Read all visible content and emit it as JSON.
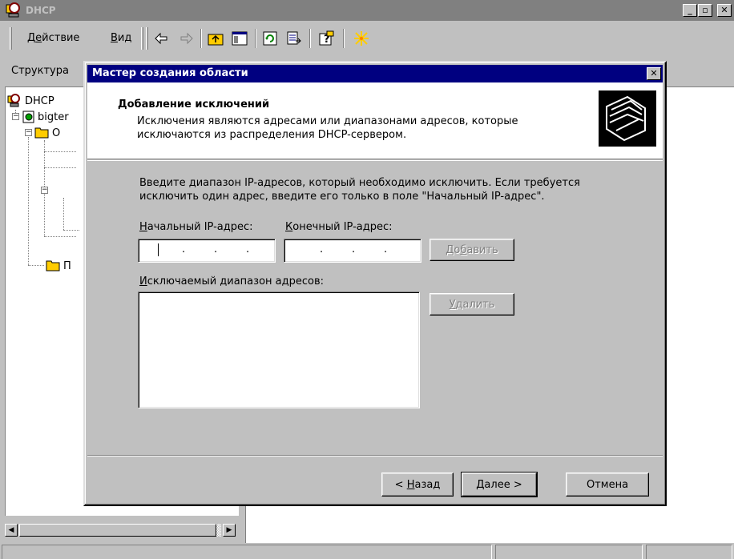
{
  "window": {
    "title": "DHCP"
  },
  "menu": {
    "action_pre": "Д",
    "action_ul": "е",
    "action_post": "йствие",
    "view_pre": "",
    "view_ul": "В",
    "view_post": "ид"
  },
  "tabs": {
    "structure": "Структура"
  },
  "tree": {
    "root": "DHCP",
    "server_partial": "bigter",
    "child1_partial": "О",
    "child2_partial": "П"
  },
  "dialog": {
    "title": "Мастер создания области",
    "header_title": "Добавление исключений",
    "header_description": "Исключения являются адресами или диапазонами адресов, которые исключаются из распределения DHCP-сервером.",
    "body_text": "Введите диапазон IP-адресов, который необходимо исключить. Если требуется исключить один адрес, введите его только в поле \"Начальный IP-адрес\".",
    "start_ip_label_ul": "Н",
    "start_ip_label_rest": "ачальный IP-адрес:",
    "end_ip_label_ul": "К",
    "end_ip_label_rest": "онечный IP-адрес:",
    "start_ip_value": "",
    "end_ip_value": "",
    "add_button_pre": "До",
    "add_button_ul": "б",
    "add_button_post": "авить",
    "excluded_label_ul": "И",
    "excluded_label_rest": "сключаемый диапазон адресов:",
    "excluded_list": [],
    "remove_button_pre": "",
    "remove_button_ul": "У",
    "remove_button_post": "далить",
    "back_button_pre": "< ",
    "back_button_ul": "Н",
    "back_button_post": "азад",
    "next_button": "Далее >",
    "cancel_button": "Отмена"
  },
  "colors": {
    "active_titlebar": "#000080",
    "inactive_titlebar": "#808080",
    "face": "#c0c0c0"
  },
  "icons": {
    "app": "dhcp-server-icon",
    "back": "arrow-left-icon",
    "forward": "arrow-right-icon",
    "up": "up-folder-icon",
    "show_hide_tree": "show-hide-tree-icon",
    "refresh": "refresh-icon",
    "export": "export-list-icon",
    "help": "help-icon",
    "new": "new-star-icon",
    "wizard": "folders-wizard-icon"
  }
}
